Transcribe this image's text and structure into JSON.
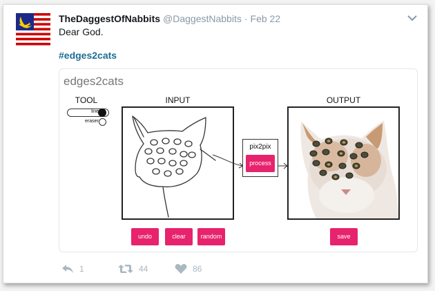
{
  "tweet": {
    "display_name": "TheDaggestOfNabbits",
    "handle": "@DaggestNabbits",
    "separator": "·",
    "date": "Feb 22",
    "text": "Dear God.",
    "hashtag": "#edges2cats"
  },
  "media": {
    "title": "edges2cats",
    "tool_label": "TOOL",
    "input_label": "INPUT",
    "output_label": "OUTPUT",
    "tool_line": "line",
    "tool_eraser": "eraser",
    "pix_label": "pix2pix",
    "process_button": "process",
    "undo_button": "undo",
    "clear_button": "clear",
    "random_button": "random",
    "save_button": "save",
    "accent_color": "#e7236d"
  },
  "actions": {
    "reply_count": "1",
    "retweet_count": "44",
    "like_count": "86",
    "icon_color": "#aab8c2"
  }
}
